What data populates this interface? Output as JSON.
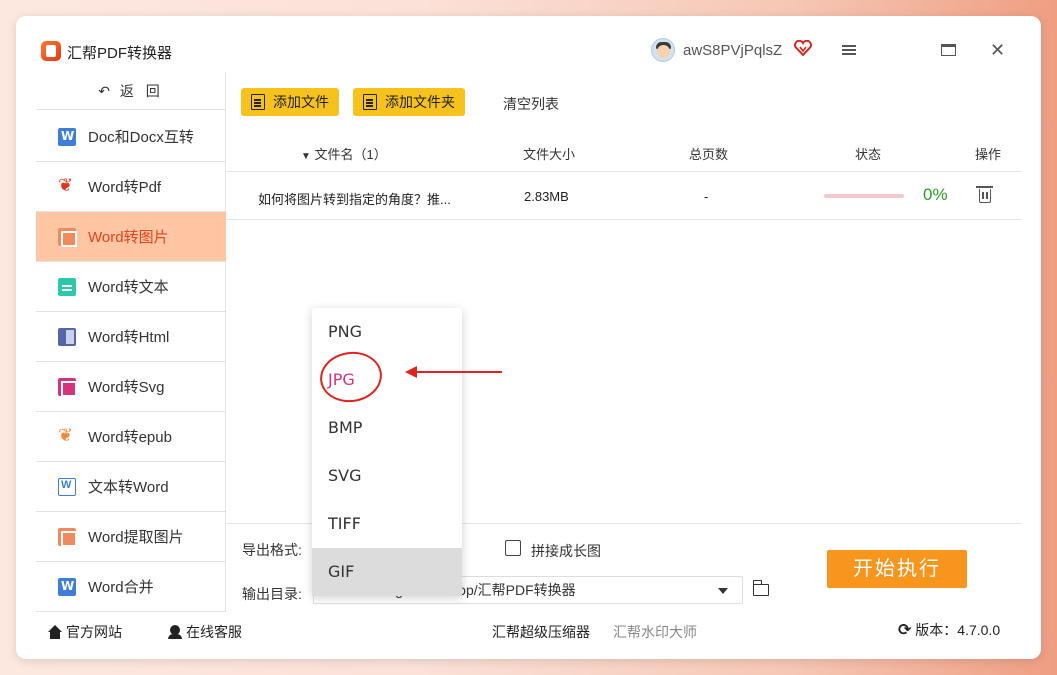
{
  "app": {
    "title": "汇帮PDF转换器",
    "username": "awS8PVjPqlsZ"
  },
  "sidebar": {
    "back_label": "返 回",
    "items": [
      {
        "label": "Doc和Docx互转",
        "icon": "word-icon"
      },
      {
        "label": "Word转Pdf",
        "icon": "pdf-icon"
      },
      {
        "label": "Word转图片",
        "icon": "image-icon",
        "active": true
      },
      {
        "label": "Word转文本",
        "icon": "text-icon"
      },
      {
        "label": "Word转Html",
        "icon": "html-icon"
      },
      {
        "label": "Word转Svg",
        "icon": "svg-icon"
      },
      {
        "label": "Word转epub",
        "icon": "epub-icon"
      },
      {
        "label": "文本转Word",
        "icon": "word-outline-icon"
      },
      {
        "label": "Word提取图片",
        "icon": "image-icon"
      },
      {
        "label": "Word合并",
        "icon": "word-icon"
      }
    ]
  },
  "toolbar": {
    "add_file": "添加文件",
    "add_folder": "添加文件夹",
    "clear_list": "清空列表"
  },
  "table": {
    "headers": {
      "name": "文件名（1）",
      "size": "文件大小",
      "pages": "总页数",
      "status": "状态",
      "action": "操作"
    },
    "rows": [
      {
        "name": "如何将图片转到指定的角度？推...",
        "size": "2.83MB",
        "pages": "-",
        "progress": "0%"
      }
    ]
  },
  "settings": {
    "format_label": "导出格式:",
    "merge_label": "拼接成长图",
    "dir_label": "输出目录:",
    "dir_value": "C:/Users/Tagao/Desktop/汇帮PDF转换器",
    "start_label": "开始执行"
  },
  "dropdown": {
    "options": [
      "PNG",
      "JPG",
      "BMP",
      "SVG",
      "TIFF",
      "GIF"
    ],
    "selected": "JPG",
    "highlighted": "GIF"
  },
  "footer": {
    "website": "官方网站",
    "support": "在线客服",
    "compressor": "汇帮超级压缩器",
    "watermark": "汇帮水印大师",
    "version": "版本：4.7.0.0"
  },
  "colors": {
    "accent": "#f8951d",
    "active_bg": "#ffc6a3",
    "active_text": "#e8431c",
    "button_yellow": "#f8c21c",
    "annotation": "#e0241b"
  }
}
